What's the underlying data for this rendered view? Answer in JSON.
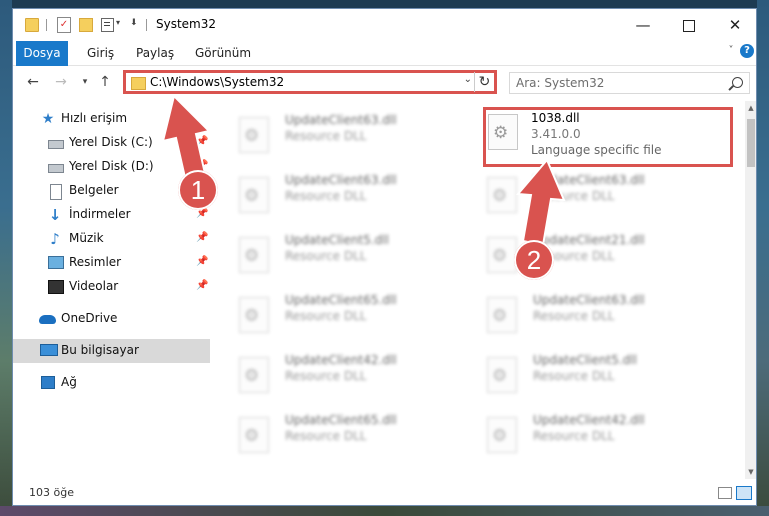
{
  "window": {
    "title": "System32",
    "controls": {
      "minimize": "—",
      "close": "✕"
    }
  },
  "ribbon": {
    "tabs": [
      "Dosya",
      "Giriş",
      "Paylaş",
      "Görünüm"
    ]
  },
  "navigation": {
    "address": "C:\\Windows\\System32",
    "search_placeholder": "Ara: System32"
  },
  "sidebar": {
    "items": [
      {
        "label": "Hızlı erişim",
        "icon": "star-icon"
      },
      {
        "label": "Yerel Disk (C:)",
        "icon": "drive-icon",
        "pinned": true
      },
      {
        "label": "Yerel Disk (D:)",
        "icon": "drive-icon",
        "pinned": true
      },
      {
        "label": "Belgeler",
        "icon": "documents-icon",
        "pinned": true
      },
      {
        "label": "İndirmeler",
        "icon": "download-icon",
        "pinned": true
      },
      {
        "label": "Müzik",
        "icon": "music-icon",
        "pinned": true
      },
      {
        "label": "Resimler",
        "icon": "pictures-icon",
        "pinned": true
      },
      {
        "label": "Videolar",
        "icon": "videos-icon",
        "pinned": true
      },
      {
        "label": "OneDrive",
        "icon": "cloud-icon"
      },
      {
        "label": "Bu bilgisayar",
        "icon": "computer-icon",
        "selected": true
      },
      {
        "label": "Ağ",
        "icon": "network-icon"
      }
    ]
  },
  "files": {
    "left_column": [
      {
        "name": "UpdateClient63.dll",
        "type": "Resource DLL"
      },
      {
        "name": "UpdateClient63.dll",
        "type": "Resource DLL"
      },
      {
        "name": "UpdateClient5.dll",
        "type": "Resource DLL"
      },
      {
        "name": "UpdateClient65.dll",
        "type": "Resource DLL"
      },
      {
        "name": "UpdateClient42.dll",
        "type": "Resource DLL"
      },
      {
        "name": "UpdateClient65.dll",
        "type": "Resource DLL"
      }
    ],
    "highlighted": {
      "name": "1038.dll",
      "version": "3.41.0.0",
      "type": "Language specific file"
    },
    "right_column": [
      {
        "name": "UpdateClient63.dll",
        "type": "Resource DLL"
      },
      {
        "name": "UpdateClient21.dll",
        "type": "Resource DLL"
      },
      {
        "name": "UpdateClient63.dll",
        "type": "Resource DLL"
      },
      {
        "name": "UpdateClient5.dll",
        "type": "Resource DLL"
      },
      {
        "name": "UpdateClient42.dll",
        "type": "Resource DLL"
      }
    ]
  },
  "status": {
    "item_count": "103 öğe"
  },
  "annotations": {
    "step1": "1",
    "step2": "2",
    "color": "#d9534f"
  }
}
